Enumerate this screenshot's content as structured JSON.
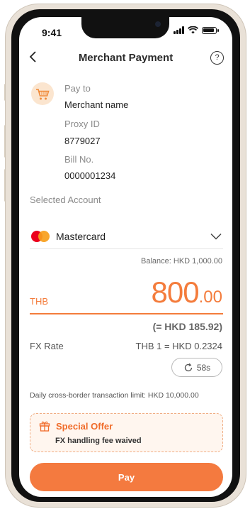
{
  "status_bar": {
    "time": "9:41"
  },
  "header": {
    "title": "Merchant Payment",
    "back_icon": "chevron-left-icon",
    "help_icon": "question-circle-icon"
  },
  "merchant": {
    "icon": "shopping-cart-icon",
    "pay_to_label": "Pay to",
    "pay_to_value": "Merchant name",
    "proxy_label": "Proxy ID",
    "proxy_value": "8779027",
    "bill_label": "Bill No.",
    "bill_value": "0000001234"
  },
  "account": {
    "label": "Selected Account",
    "name": "Mastercard",
    "balance": "Balance: HKD 1,000.00",
    "dropdown_icon": "chevron-down-icon"
  },
  "amount": {
    "currency": "THB",
    "whole": "800",
    "fraction": ".00",
    "converted": "(= HKD 185.92)"
  },
  "fx": {
    "label": "FX Rate",
    "rate": "THB 1 = HKD 0.2324",
    "countdown": "58s",
    "refresh_icon": "refresh-icon"
  },
  "limit_text": "Daily cross-border transaction limit: HKD 10,000.00",
  "offer": {
    "icon": "gift-icon",
    "title": "Special Offer",
    "subtitle": "FX handling fee waived"
  },
  "pay_button": {
    "label": "Pay"
  },
  "colors": {
    "accent": "#f47a3f",
    "mastercard_red": "#eb001b",
    "mastercard_orange": "#f79e1b"
  }
}
